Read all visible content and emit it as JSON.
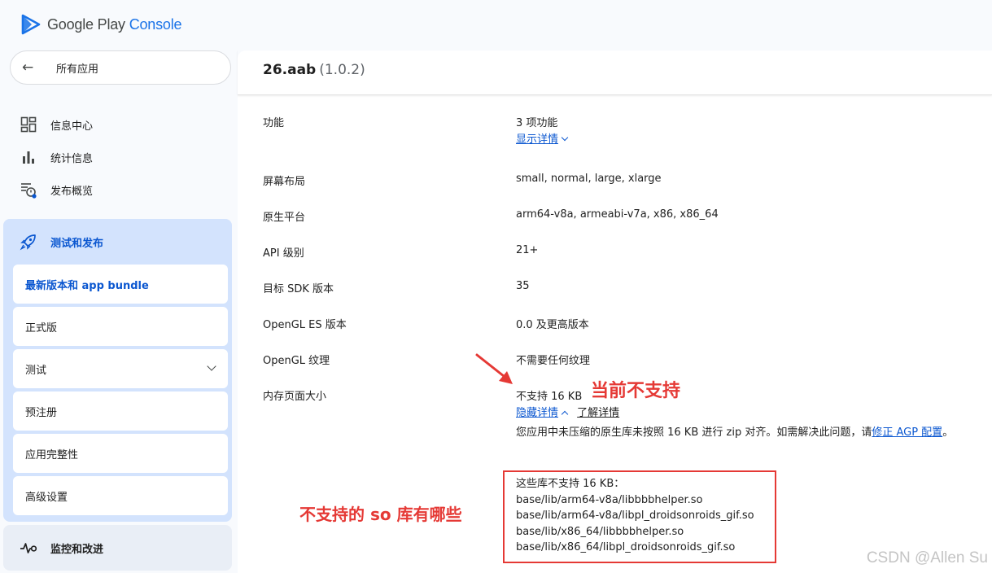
{
  "brand": {
    "prefix": "Google Play",
    "suffix": "Console"
  },
  "nav": {
    "back_label": "所有应用",
    "items": [
      {
        "label": "信息中心",
        "icon": "dashboard-icon"
      },
      {
        "label": "统计信息",
        "icon": "bar-chart-icon"
      },
      {
        "label": "发布概览",
        "icon": "publishing-overview-icon"
      }
    ],
    "release_group": {
      "label": "测试和发布",
      "icon": "rocket-icon",
      "items": [
        {
          "label": "最新版本和 app bundle",
          "active": true
        },
        {
          "label": "正式版"
        },
        {
          "label": "测试",
          "expandable": true
        },
        {
          "label": "预注册"
        },
        {
          "label": "应用完整性"
        },
        {
          "label": "高级设置"
        }
      ]
    },
    "monitor": {
      "label": "监控和改进",
      "icon": "vitals-icon"
    }
  },
  "bundle": {
    "name": "26.aab",
    "version": "(1.0.2)"
  },
  "details": {
    "features_label": "功能",
    "features_value": "3 项功能",
    "features_link": "显示详情",
    "screen_label": "屏幕布局",
    "screen_value": "small, normal, large, xlarge",
    "native_label": "原生平台",
    "native_value": "arm64-v8a, armeabi-v7a, x86, x86_64",
    "api_label": "API 级别",
    "api_value": "21+",
    "sdk_label": "目标 SDK 版本",
    "sdk_value": "35",
    "gles_label": "OpenGL ES 版本",
    "gles_value": "0.0 及更高版本",
    "gltex_label": "OpenGL 纹理",
    "gltex_value": "不需要任何纹理",
    "mem_label": "内存页面大小",
    "mem_value": "不支持 16 KB",
    "hide_link": "隐藏详情",
    "learn_link": "了解详情",
    "description": "您应用中未压缩的原生库未按照 16 KB 进行 zip 对齐。如需解决此问题，请",
    "fix_link": "修正 AGP 配置",
    "description_end": "。",
    "libs_title": "这些库不支持 16 KB：",
    "libs": [
      "base/lib/arm64-v8a/libbbbhelper.so",
      "base/lib/arm64-v8a/libpl_droidsonroids_gif.so",
      "base/lib/x86_64/libbbbhelper.so",
      "base/lib/x86_64/libpl_droidsonroids_gif.so"
    ]
  },
  "annotations": {
    "current_unsupported": "当前不支持",
    "which_so": "不支持的 so 库有哪些",
    "color": "#e53935"
  },
  "watermark": "CSDN @Allen Su"
}
